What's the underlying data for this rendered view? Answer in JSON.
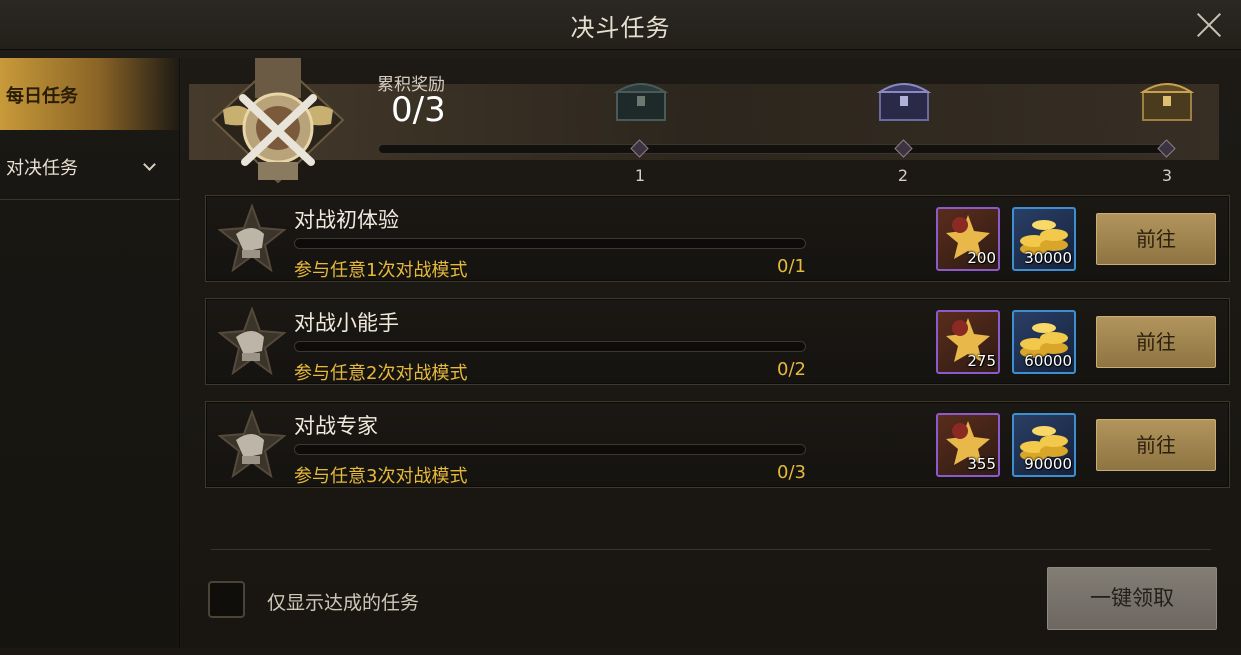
{
  "window": {
    "title": "决斗任务"
  },
  "sidebar": {
    "items": [
      {
        "label": "每日任务",
        "active": true
      },
      {
        "label": "对决任务",
        "active": false,
        "expandable": true
      }
    ]
  },
  "reward_track": {
    "label": "累积奖励",
    "progress_text": "0/3",
    "progress_fraction": 0.0,
    "milestones": [
      "1",
      "2",
      "3"
    ],
    "chest_icons": [
      "green-chest-icon",
      "blue-chest-icon",
      "gold-chest-icon"
    ]
  },
  "tasks": [
    {
      "title": "对战初体验",
      "description": "参与任意1次对战模式",
      "progress": "0/1",
      "progress_fraction": 0.0,
      "rewards": [
        {
          "icon": "honor-badge-icon",
          "qty": "200",
          "rarity": "purple"
        },
        {
          "icon": "gold-coins-icon",
          "qty": "30000",
          "rarity": "blue"
        }
      ],
      "button_label": "前往"
    },
    {
      "title": "对战小能手",
      "description": "参与任意2次对战模式",
      "progress": "0/2",
      "progress_fraction": 0.0,
      "rewards": [
        {
          "icon": "honor-badge-icon",
          "qty": "275",
          "rarity": "purple"
        },
        {
          "icon": "gold-coins-icon",
          "qty": "60000",
          "rarity": "blue"
        }
      ],
      "button_label": "前往"
    },
    {
      "title": "对战专家",
      "description": "参与任意3次对战模式",
      "progress": "0/3",
      "progress_fraction": 0.0,
      "rewards": [
        {
          "icon": "honor-badge-icon",
          "qty": "355",
          "rarity": "purple"
        },
        {
          "icon": "gold-coins-icon",
          "qty": "90000",
          "rarity": "blue"
        }
      ],
      "button_label": "前往"
    }
  ],
  "footer": {
    "checkbox_label": "仅显示达成的任务",
    "checkbox_checked": false,
    "claim_all_label": "一键领取",
    "claim_all_enabled": false
  },
  "colors": {
    "accent_gold": "#e6b93a",
    "tab_active": "#c89a3a",
    "rarity_purple": "#8c5bc9",
    "rarity_blue": "#3d8fd0"
  }
}
